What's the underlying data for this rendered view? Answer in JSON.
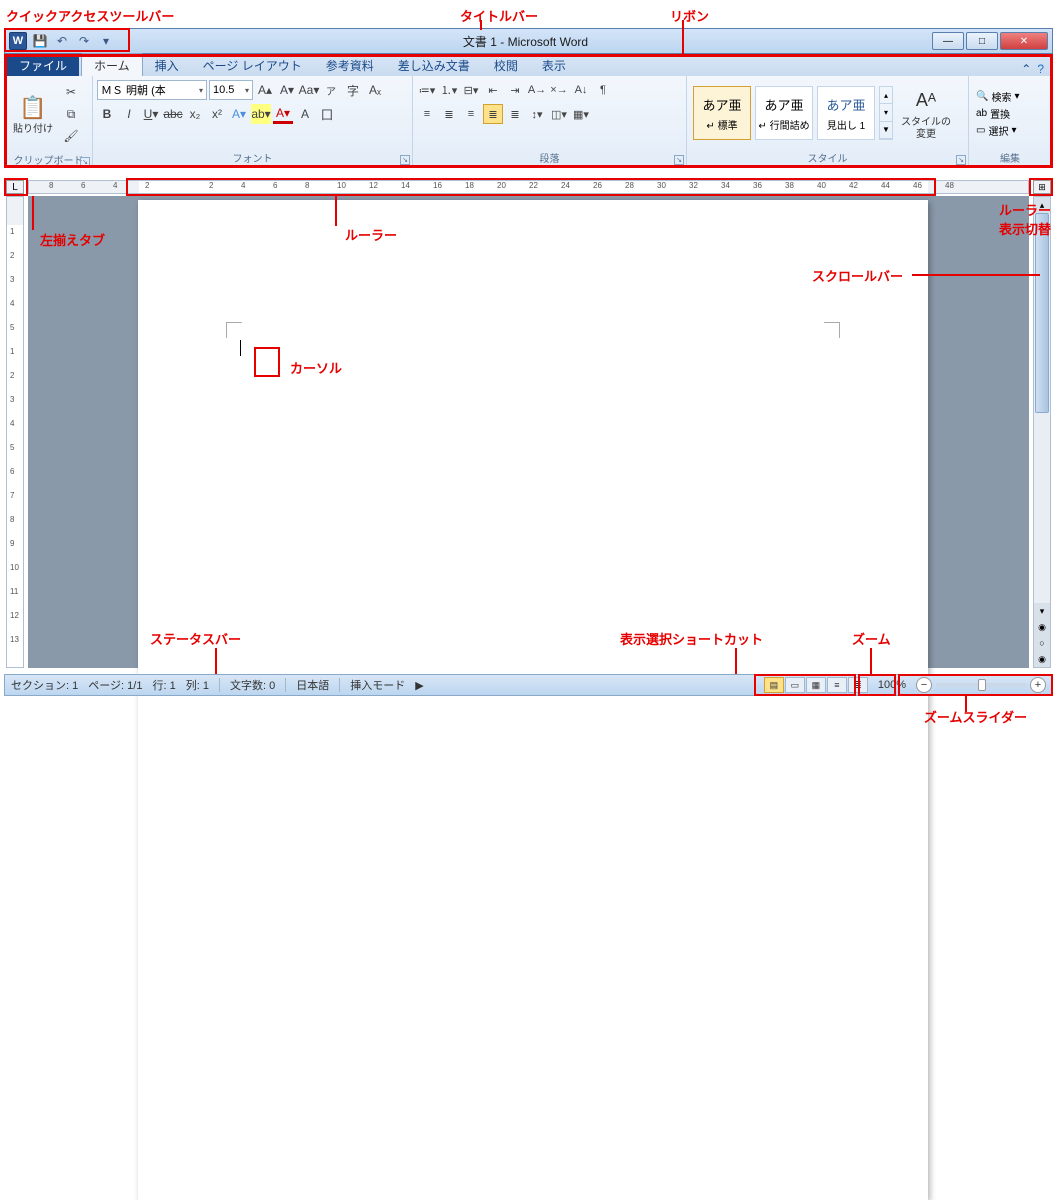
{
  "annotations": {
    "quick_access": "クイックアクセスツールバー",
    "title_bar": "タイトルバー",
    "ribbon": "リボン",
    "left_tab": "左揃えタブ",
    "ruler": "ルーラー",
    "ruler_toggle": "ルーラー\n表示切替",
    "cursor": "カーソル",
    "scrollbar": "スクロールバー",
    "status_bar": "ステータスバー",
    "view_shortcut": "表示選択ショートカット",
    "zoom": "ズーム",
    "zoom_slider": "ズームスライダー"
  },
  "title": "文書 1 - Microsoft Word",
  "tabs": {
    "file": "ファイル",
    "home": "ホーム",
    "insert": "挿入",
    "layout": "ページ レイアウト",
    "references": "参考資料",
    "mailings": "差し込み文書",
    "review": "校閲",
    "view": "表示"
  },
  "groups": {
    "clipboard": "クリップボード",
    "font": "フォント",
    "paragraph": "段落",
    "styles": "スタイル",
    "editing": "編集"
  },
  "clipboard": {
    "paste": "貼り付け"
  },
  "font": {
    "name": "ＭＳ 明朝 (本",
    "size": "10.5"
  },
  "styles": {
    "item1": {
      "preview": "あア亜",
      "name": "↵ 標準"
    },
    "item2": {
      "preview": "あア亜",
      "name": "↵ 行間詰め"
    },
    "item3": {
      "preview": "あア亜",
      "name": "見出し 1"
    },
    "change": "スタイルの\n変更"
  },
  "editing": {
    "find": "検索",
    "replace": "置換",
    "select": "選択"
  },
  "status": {
    "section": "セクション:",
    "section_val": "1",
    "page": "ページ:",
    "page_val": "1/1",
    "line": "行:",
    "line_val": "1",
    "col": "列:",
    "col_val": "1",
    "words": "文字数:",
    "words_val": "0",
    "lang": "日本語",
    "mode": "挿入モード",
    "zoom": "100%"
  },
  "ruler_h": [
    "8",
    "6",
    "4",
    "2",
    "",
    "2",
    "4",
    "6",
    "8",
    "10",
    "12",
    "14",
    "16",
    "18",
    "20",
    "22",
    "24",
    "26",
    "28",
    "30",
    "32",
    "34",
    "36",
    "38",
    "40",
    "42",
    "44",
    "46",
    "48"
  ],
  "ruler_v": [
    "",
    "1",
    "2",
    "3",
    "4",
    "5",
    "1",
    "2",
    "3",
    "4",
    "5",
    "6",
    "7",
    "8",
    "9",
    "10",
    "11",
    "12",
    "13"
  ]
}
